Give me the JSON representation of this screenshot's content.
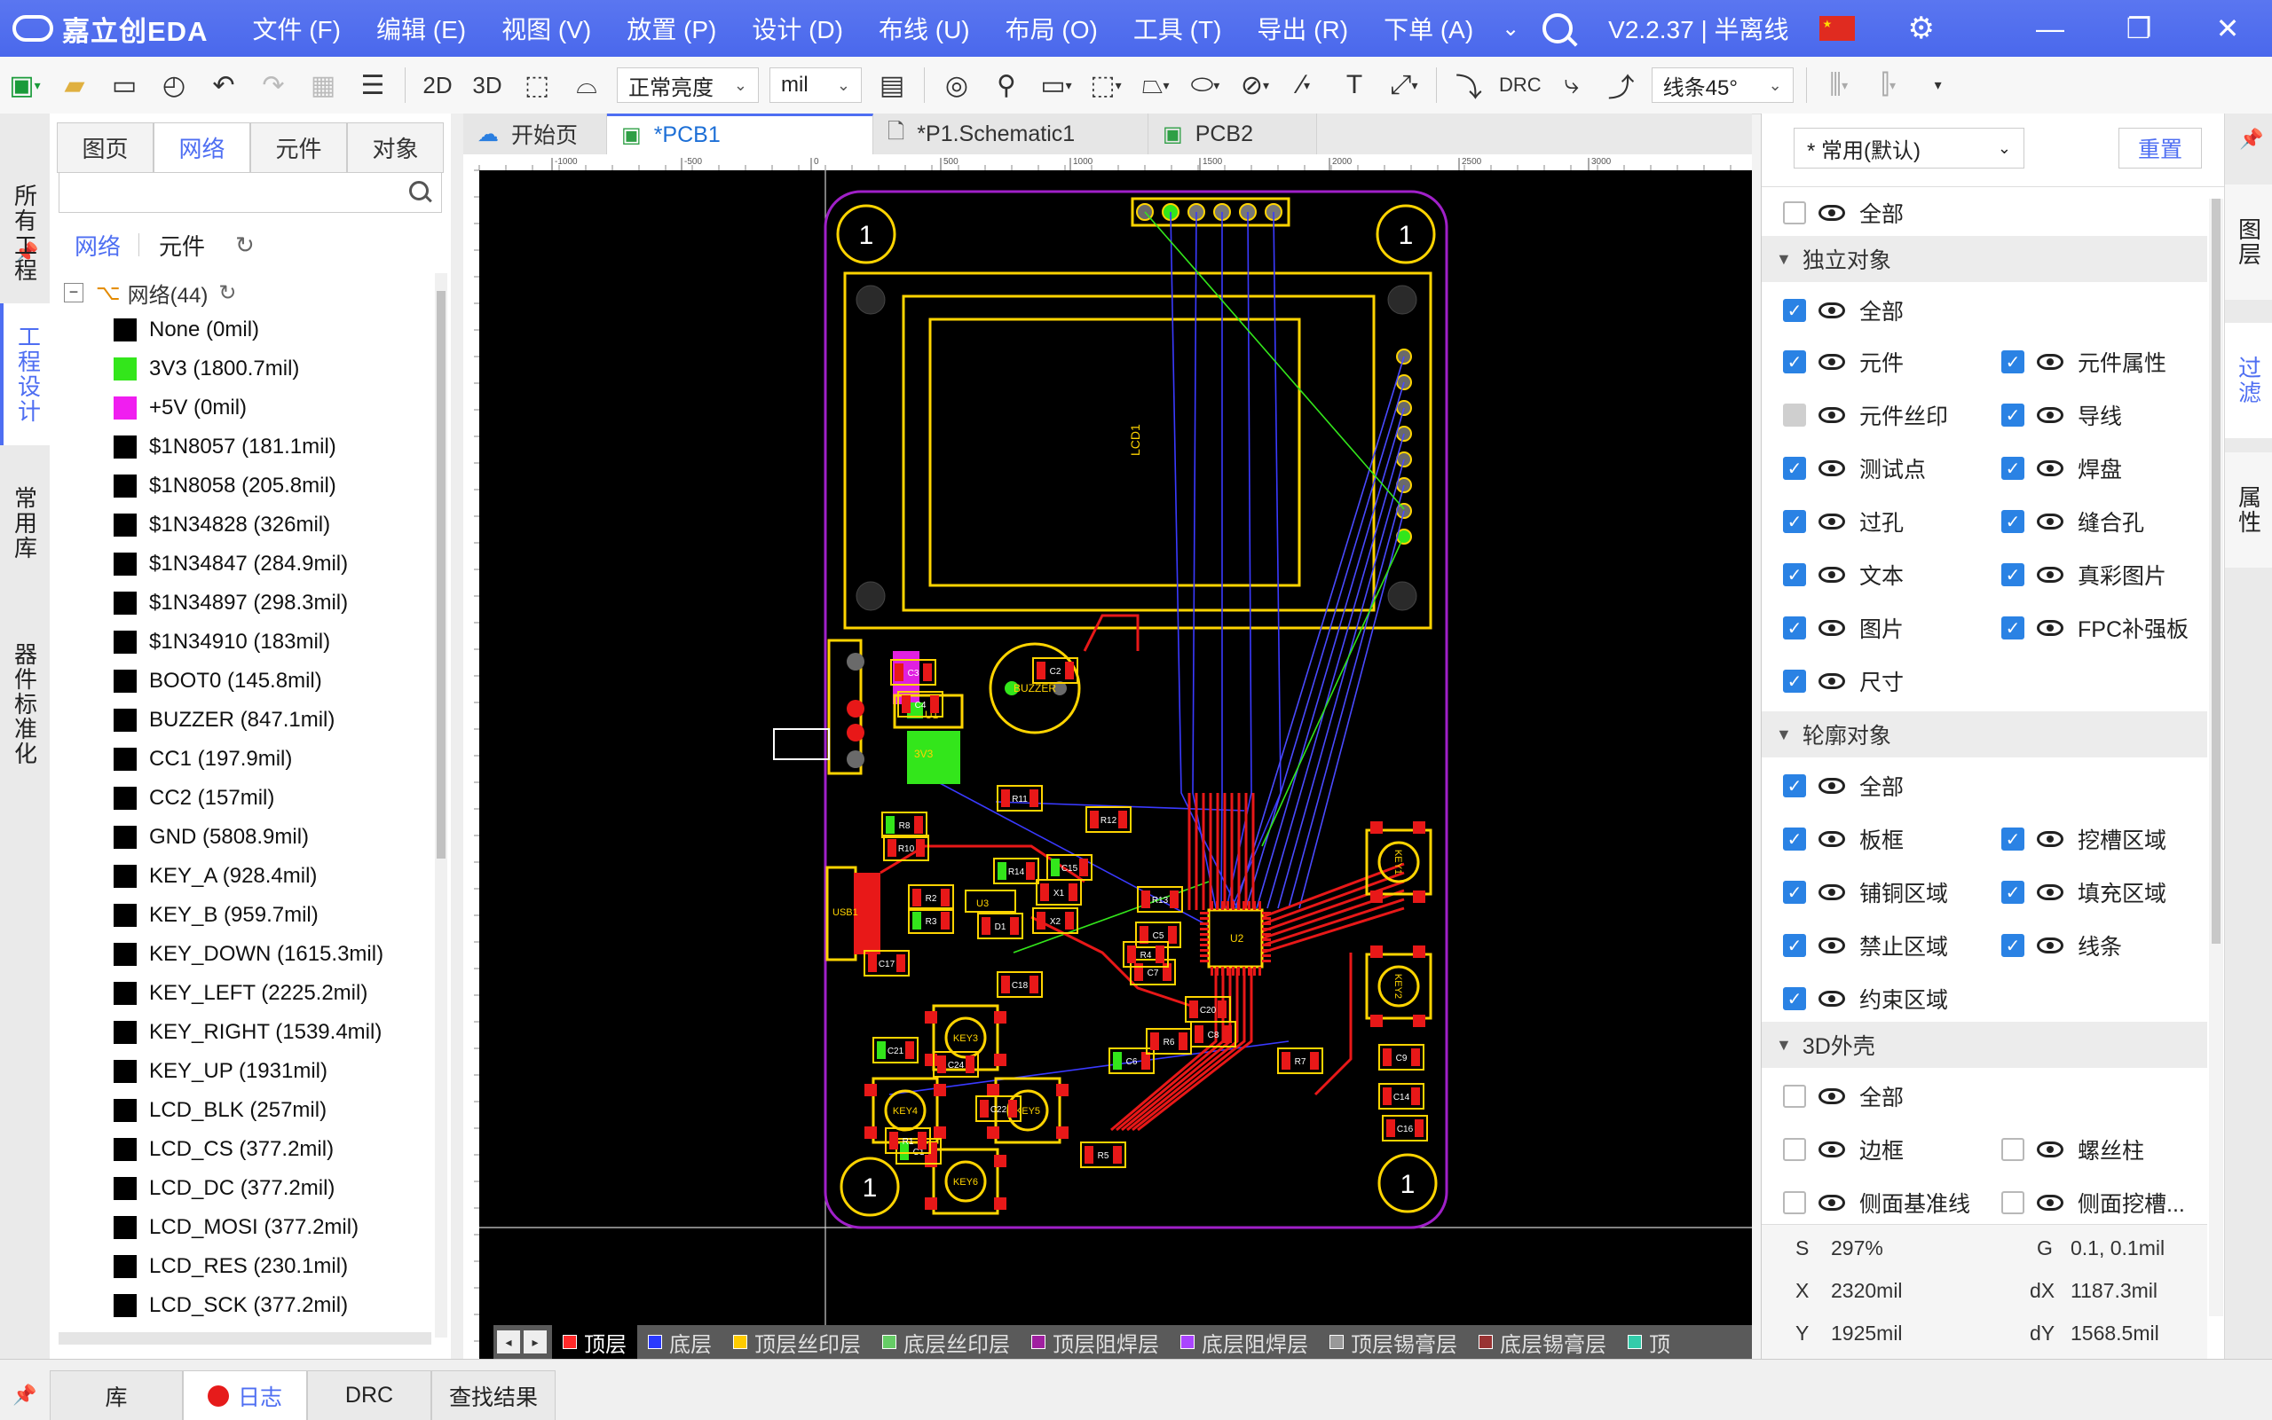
{
  "app": {
    "name": "嘉立创EDA",
    "version": "V2.2.37 | 半离线",
    "menus": [
      "文件 (F)",
      "编辑 (E)",
      "视图 (V)",
      "放置 (P)",
      "设计 (D)",
      "布线 (U)",
      "布局 (O)",
      "工具 (T)",
      "导出 (R)",
      "下单 (A)"
    ],
    "accent": "#4e6ef2"
  },
  "toolbar": {
    "view2d": "2D",
    "view3d": "3D",
    "brightness": "正常亮度",
    "unit": "mil",
    "drc": "DRC",
    "route_angle": "线条45°"
  },
  "left_rail": [
    "所有工程",
    "工程设计",
    "常用库",
    "器件标准化"
  ],
  "left_panel": {
    "tabs": [
      "图页",
      "网络",
      "元件",
      "对象"
    ],
    "active_tab": "网络",
    "search_placeholder": "",
    "subtabs": [
      "网络",
      "元件"
    ],
    "root_label": "网络(44)",
    "nets": [
      {
        "name": "None (0mil)",
        "color": "#000000"
      },
      {
        "name": "3V3 (1800.7mil)",
        "color": "#33e61b"
      },
      {
        "name": "+5V (0mil)",
        "color": "#f01ef0"
      },
      {
        "name": "$1N8057 (181.1mil)",
        "color": "#000000"
      },
      {
        "name": "$1N8058 (205.8mil)",
        "color": "#000000"
      },
      {
        "name": "$1N34828 (326mil)",
        "color": "#000000"
      },
      {
        "name": "$1N34847 (284.9mil)",
        "color": "#000000"
      },
      {
        "name": "$1N34897 (298.3mil)",
        "color": "#000000"
      },
      {
        "name": "$1N34910 (183mil)",
        "color": "#000000"
      },
      {
        "name": "BOOT0 (145.8mil)",
        "color": "#000000"
      },
      {
        "name": "BUZZER (847.1mil)",
        "color": "#000000"
      },
      {
        "name": "CC1 (197.9mil)",
        "color": "#000000"
      },
      {
        "name": "CC2 (157mil)",
        "color": "#000000"
      },
      {
        "name": "GND (5808.9mil)",
        "color": "#000000"
      },
      {
        "name": "KEY_A (928.4mil)",
        "color": "#000000"
      },
      {
        "name": "KEY_B (959.7mil)",
        "color": "#000000"
      },
      {
        "name": "KEY_DOWN (1615.3mil)",
        "color": "#000000"
      },
      {
        "name": "KEY_LEFT (2225.2mil)",
        "color": "#000000"
      },
      {
        "name": "KEY_RIGHT (1539.4mil)",
        "color": "#000000"
      },
      {
        "name": "KEY_UP (1931mil)",
        "color": "#000000"
      },
      {
        "name": "LCD_BLK (257mil)",
        "color": "#000000"
      },
      {
        "name": "LCD_CS (377.2mil)",
        "color": "#000000"
      },
      {
        "name": "LCD_DC (377.2mil)",
        "color": "#000000"
      },
      {
        "name": "LCD_MOSI (377.2mil)",
        "color": "#000000"
      },
      {
        "name": "LCD_RES (230.1mil)",
        "color": "#000000"
      },
      {
        "name": "LCD_SCK (377.2mil)",
        "color": "#000000"
      }
    ]
  },
  "doc_tabs": [
    {
      "label": "开始页",
      "icon": "cloud-icon",
      "active": false
    },
    {
      "label": "*PCB1",
      "icon": "pcb-icon",
      "active": true
    },
    {
      "label": "*P1.Schematic1",
      "icon": "schematic-icon",
      "active": false
    },
    {
      "label": "PCB2",
      "icon": "pcb-icon",
      "active": false
    }
  ],
  "ruler_labels": [
    "-1000",
    "-500",
    "0",
    "500",
    "1000",
    "1500",
    "2000",
    "2500",
    "3000"
  ],
  "pcb": {
    "silk_labels": {
      "lcd": "LCD1",
      "buzzer": "BUZZER",
      "u1": "U1",
      "u2": "U2",
      "u3": "U3",
      "usb": "USB1",
      "net3v3": "3V3",
      "hole": "1"
    },
    "keys": [
      "KEY1",
      "KEY2",
      "KEY3",
      "KEY4",
      "KEY5",
      "KEY6"
    ],
    "refs": [
      "C1",
      "C2",
      "C3",
      "C4",
      "C5",
      "C6",
      "C7",
      "C8",
      "C9",
      "C14",
      "C15",
      "C16",
      "C17",
      "C18",
      "C20",
      "C21",
      "C22",
      "C24",
      "R1",
      "R2",
      "R3",
      "R4",
      "R5",
      "R6",
      "R7",
      "R8",
      "R10",
      "R11",
      "R12",
      "R13",
      "R14",
      "X1",
      "X2",
      "D1"
    ]
  },
  "layers": [
    {
      "label": "顶层",
      "color": "#ff2a2a",
      "active": true
    },
    {
      "label": "底层",
      "color": "#2a3aff",
      "active": false
    },
    {
      "label": "顶层丝印层",
      "color": "#ffcc00",
      "active": false
    },
    {
      "label": "底层丝印层",
      "color": "#66cc66",
      "active": false
    },
    {
      "label": "顶层阻焊层",
      "color": "#a020a0",
      "active": false
    },
    {
      "label": "底层阻焊层",
      "color": "#aa44ff",
      "active": false
    },
    {
      "label": "顶层锡膏层",
      "color": "#999999",
      "active": false
    },
    {
      "label": "底层锡膏层",
      "color": "#993333",
      "active": false
    },
    {
      "label": "顶",
      "color": "#33ccaa",
      "active": false
    }
  ],
  "right_panel": {
    "preset": "* 常用(默认)",
    "reset": "重置",
    "all_top": "全部",
    "sections": {
      "standalone": "独立对象",
      "outline": "轮廓对象",
      "shell3d": "3D外壳"
    },
    "all": "全部",
    "standalone_items": [
      [
        "元件",
        "元件属性"
      ],
      [
        "元件丝印",
        "导线"
      ],
      [
        "测试点",
        "焊盘"
      ],
      [
        "过孔",
        "缝合孔"
      ],
      [
        "文本",
        "真彩图片"
      ],
      [
        "图片",
        "FPC补强板"
      ],
      [
        "尺寸",
        ""
      ]
    ],
    "outline_items": [
      [
        "板框",
        "挖槽区域"
      ],
      [
        "铺铜区域",
        "填充区域"
      ],
      [
        "禁止区域",
        "线条"
      ],
      [
        "约束区域",
        ""
      ]
    ],
    "shell_items": [
      [
        "边框",
        "螺丝柱"
      ],
      [
        "侧面基准线",
        "侧面挖槽..."
      ]
    ],
    "status": {
      "S": "297%",
      "G": "0.1, 0.1mil",
      "X": "2320mil",
      "dX": "1187.3mil",
      "Y": "1925mil",
      "dY": "1568.5mil"
    }
  },
  "right_rail": [
    "图层",
    "过滤",
    "属性"
  ],
  "bottom_tabs": [
    "库",
    "日志",
    "DRC",
    "查找结果"
  ]
}
